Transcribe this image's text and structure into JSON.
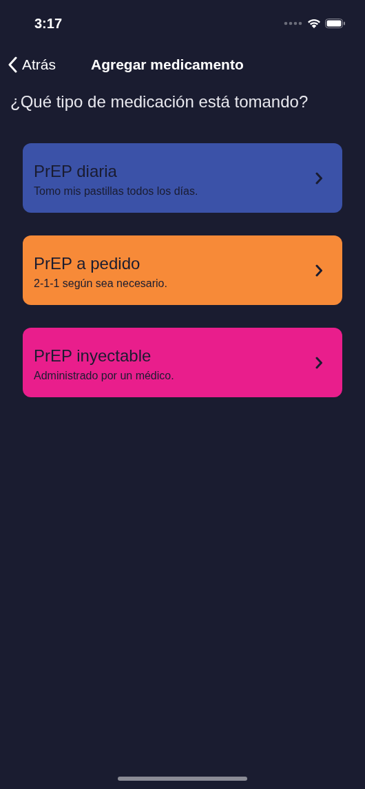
{
  "status_bar": {
    "time": "3:17"
  },
  "nav": {
    "back": "Atrás",
    "title": "Agregar medicamento"
  },
  "question": "¿Qué tipo de medicación está tomando?",
  "options": [
    {
      "title": "PrEP diaria",
      "subtitle": "Tomo mis pastillas todos los días.",
      "color": "#3b52a8"
    },
    {
      "title": "PrEP a pedido",
      "subtitle": "2-1-1 según sea necesario.",
      "color": "#f78a38"
    },
    {
      "title": "PrEP inyectable",
      "subtitle": "Administrado por un médico.",
      "color": "#e91e8c"
    }
  ]
}
